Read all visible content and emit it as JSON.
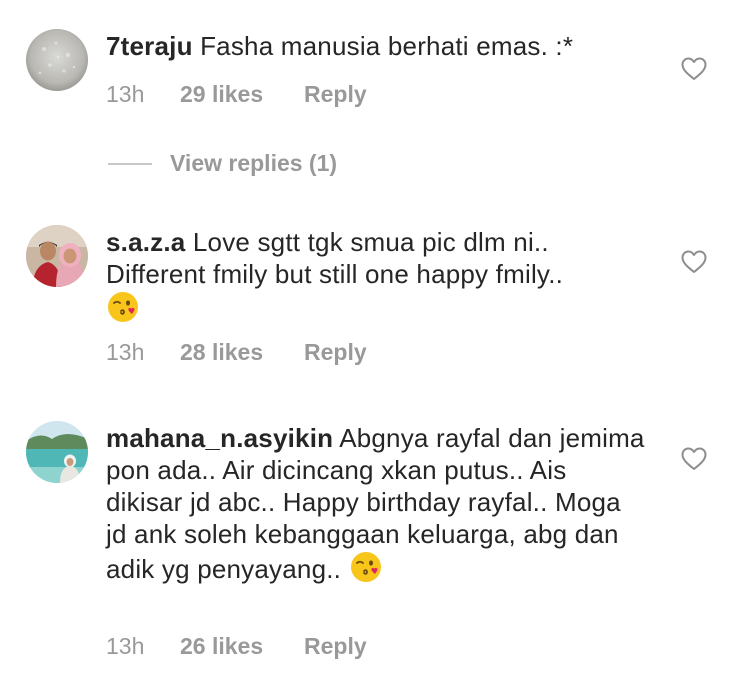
{
  "comments": [
    {
      "username": "7teraju",
      "text": " Fasha manusia berhati emas. :*",
      "emoji": "",
      "time": "13h",
      "likes": "29 likes",
      "reply": "Reply",
      "avatar_icon": "grey-texture-avatar"
    },
    {
      "username": "s.a.z.a",
      "text": " Love sgtt tgk smua pic dlm ni.. Different fmily but still one happy fmily..",
      "emoji": "face-blowing-a-kiss",
      "time": "13h",
      "likes": "28 likes",
      "reply": "Reply",
      "avatar_icon": "couple-photo-avatar"
    },
    {
      "username": "mahana_n.asyikin",
      "text": " Abgnya rayfal dan jemima pon ada.. Air dicincang xkan putus.. Ais dikisar jd abc.. Happy birthday rayfal.. Moga jd ank soleh kebanggaan keluarga, abg dan adik yg penyayang..",
      "emoji": "face-blowing-a-kiss",
      "time": "13h",
      "likes": "26 likes",
      "reply": "Reply",
      "avatar_icon": "beach-photo-avatar"
    }
  ],
  "view_replies": {
    "label": "View replies (1)"
  },
  "icons": {
    "like": "heart-outline-icon"
  },
  "colors": {
    "text": "#262626",
    "meta": "#999999",
    "divider": "#c7c7c7"
  }
}
